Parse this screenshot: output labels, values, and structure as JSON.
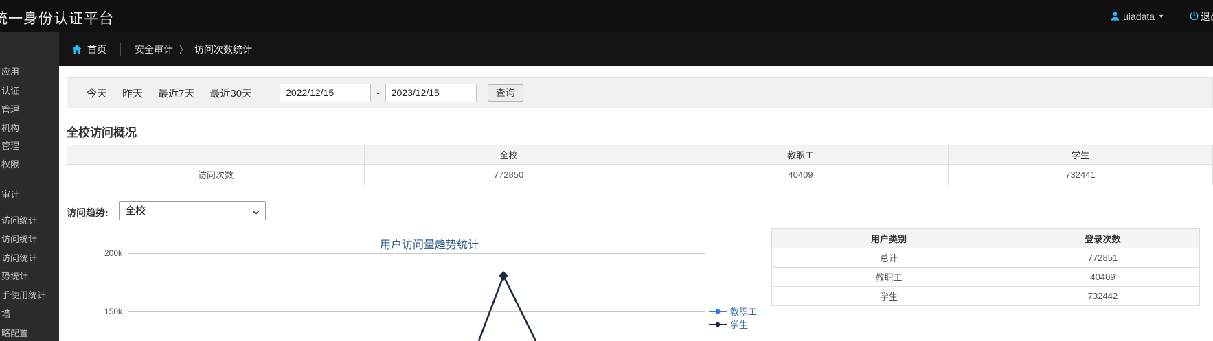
{
  "colors": {
    "accent_blue": "#29b6f6",
    "chart_title_blue": "#2b5c8d",
    "chart_line_navy": "#1c2b40",
    "series_teacher_blue": "#2f7ed8",
    "legend_text_blue": "#3272a8"
  },
  "header": {
    "title": "统一身份认证平台",
    "username": "uiadata",
    "logout_label": "退出"
  },
  "breadcrumb": {
    "home_label": "首页",
    "section": "安全审计",
    "separator": "〉",
    "page": "访问次数统计"
  },
  "sidebar": {
    "items": [
      "应用",
      "认证",
      "管理",
      "机构",
      "管理",
      "权限",
      "审计",
      "访问统计",
      "访问统计",
      "访问统计",
      "势统计",
      "手使用统计",
      "墙",
      "略配置"
    ]
  },
  "filters": {
    "quick_links": [
      "今天",
      "昨天",
      "最近7天",
      "最近30天"
    ],
    "date_start": "2022/12/15",
    "date_separator": "-",
    "date_end": "2023/12/15",
    "query_button": "查询"
  },
  "overview": {
    "section_title": "全校访问概况",
    "table": {
      "headers": [
        "",
        "全校",
        "教职工",
        "学生"
      ],
      "row_label": "访问次数",
      "values": [
        "772850",
        "40409",
        "732441"
      ]
    }
  },
  "trend": {
    "label": "访问趋势:",
    "selected_option": "全校"
  },
  "chart_data": {
    "type": "line",
    "title": "用户访问量趋势统计",
    "y_tick_labels_visible": [
      "200k",
      "150k"
    ],
    "y_gridline_values": [
      200000,
      150000
    ],
    "legend_position": "right",
    "series": [
      {
        "name": "教职工",
        "color": "#2f7ed8"
      },
      {
        "name": "学生",
        "color": "#1c2b40",
        "visible_peak_value": 180000
      }
    ],
    "clipped_bottom": true
  },
  "login_table": {
    "headers": [
      "用户类别",
      "登录次数"
    ],
    "rows": [
      {
        "category": "总计",
        "count": "772851"
      },
      {
        "category": "教职工",
        "count": "40409"
      },
      {
        "category": "学生",
        "count": "732442"
      }
    ]
  }
}
